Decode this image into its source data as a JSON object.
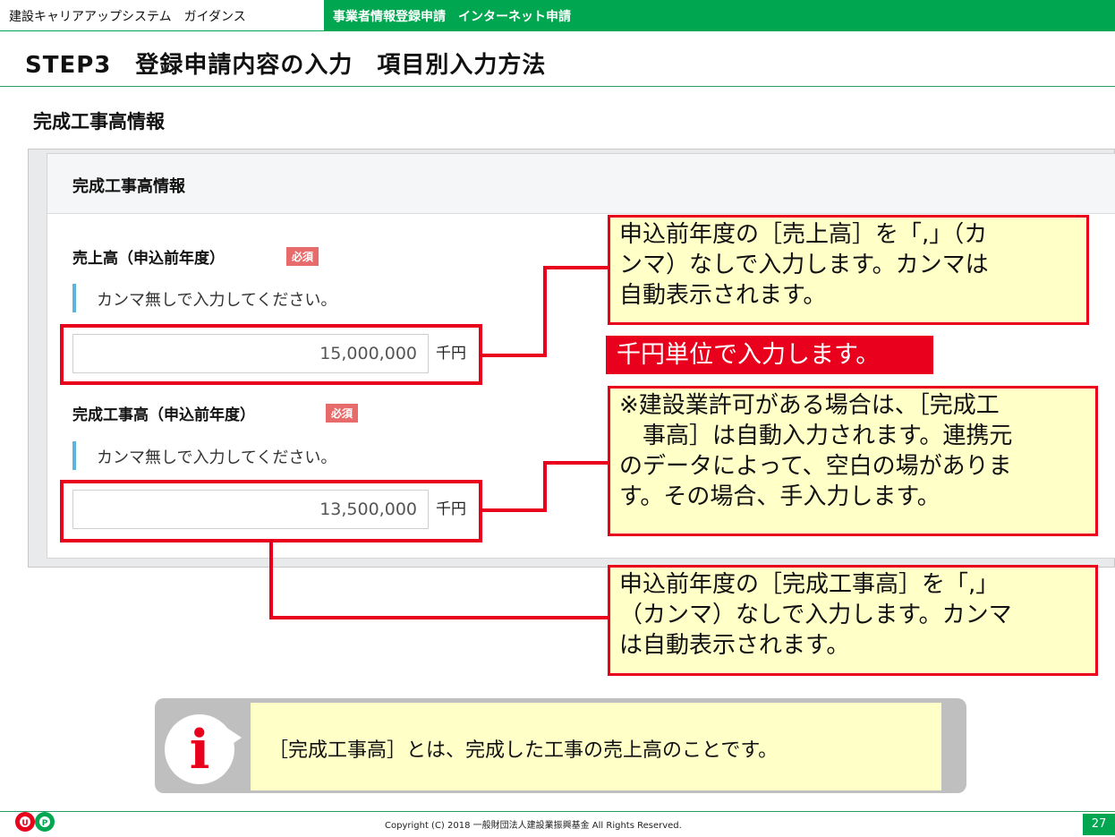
{
  "header": {
    "left_title": "建設キャリアアップシステム　ガイダンス",
    "right_title": "事業者情報登録申請　インターネット申請"
  },
  "page_title": "STEP3　登録申請内容の入力　項目別入力方法",
  "section_heading": "完成工事高情報",
  "panel": {
    "header": "完成工事高情報",
    "fields": [
      {
        "label": "売上高（申込前年度）",
        "badge": "必須",
        "hint": "カンマ無しで入力してください。",
        "value": "15,000,000",
        "unit": "千円"
      },
      {
        "label": "完成工事高（申込前年度）",
        "badge": "必須",
        "hint": "カンマ無しで入力してください。",
        "value": "13,500,000",
        "unit": "千円"
      }
    ]
  },
  "callouts": {
    "sales_line1": "申込前年度の［売上高］を「,」（カ",
    "sales_line2": "ンマ）なしで入力します。カンマは",
    "sales_line3": "自動表示されます。",
    "unit_note": "千円単位で入力します。",
    "permit_line1": "※建設業許可がある場合は、［完成工",
    "permit_line2": "　事高］は自動入力されます。連携元",
    "permit_line3": "のデータによって、空白の場がありま",
    "permit_line4": "す。その場合、手入力します。",
    "completed_line1": "申込前年度の［完成工事高］を「,」",
    "completed_line2": "（カンマ）なしで入力します。カンマ",
    "completed_line3": "は自動表示されます。"
  },
  "info": {
    "icon": "info-icon",
    "text": "［完成工事高］とは、完成した工事の売上高のことです。"
  },
  "footer": {
    "logo_text": "CCUS",
    "copyright": "Copyright (C) 2018 一般財団法人建設業振興基金 All Rights Reserved.",
    "page_number": "27"
  },
  "colors": {
    "brand_green": "#00a650",
    "callout_red": "#e8001c",
    "callout_fill": "#ffffc8",
    "required_badge": "#e86b6b",
    "hint_bar": "#5bb5dd"
  }
}
